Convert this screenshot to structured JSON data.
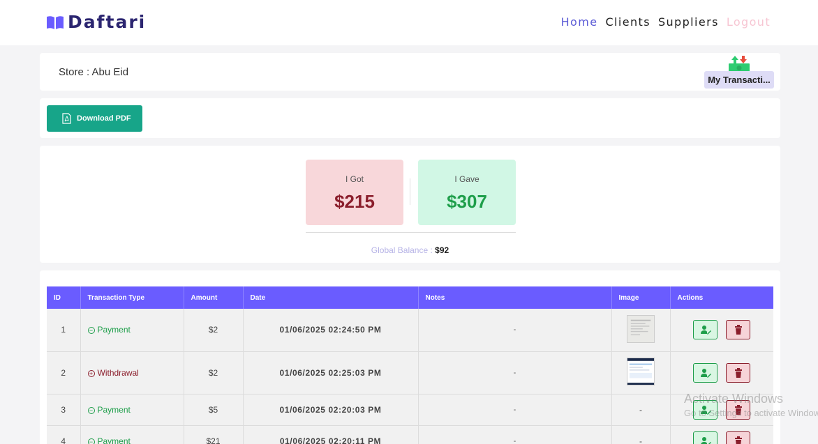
{
  "nav": {
    "brand": "Daftari",
    "links": [
      "Home",
      "Clients",
      "Suppliers",
      "Logout"
    ]
  },
  "store": {
    "label": "Store : Abu Eid",
    "transactions_button": "My Transacti..."
  },
  "toolbar": {
    "pdf_label": "Download PDF"
  },
  "summary": {
    "got_label": "I Got",
    "got_amount": "215",
    "gave_label": "I Gave",
    "gave_amount": "307",
    "currency": "$",
    "balance_label": "Global Balance :",
    "balance_value": "92"
  },
  "table": {
    "headers": [
      "ID",
      "Transaction Type",
      "Amount",
      "Date",
      "Notes",
      "Image",
      "Actions"
    ],
    "rows": [
      {
        "id": "1",
        "type": "Payment",
        "amount": "$2",
        "date": "01/06/2025 02:24:50 PM",
        "notes": "-",
        "image": ""
      },
      {
        "id": "2",
        "type": "Withdrawal",
        "amount": "$2",
        "date": "01/06/2025 02:25:03 PM",
        "notes": "-",
        "image": ""
      },
      {
        "id": "3",
        "type": "Payment",
        "amount": "$5",
        "date": "01/06/2025 02:20:03 PM",
        "notes": "-",
        "image": "-"
      },
      {
        "id": "4",
        "type": "Payment",
        "amount": "$21",
        "date": "01/06/2025 02:20:11 PM",
        "notes": "-",
        "image": "-"
      }
    ]
  },
  "watermark": {
    "line1": "Activate Windows",
    "line2": "Go to Settings to activate Windows."
  },
  "colors": {
    "accent": "#6a5cff",
    "brand": "#2b2570",
    "got": "#8b1e2c",
    "gave": "#1e9e4a",
    "pdf_button": "#17a589"
  }
}
